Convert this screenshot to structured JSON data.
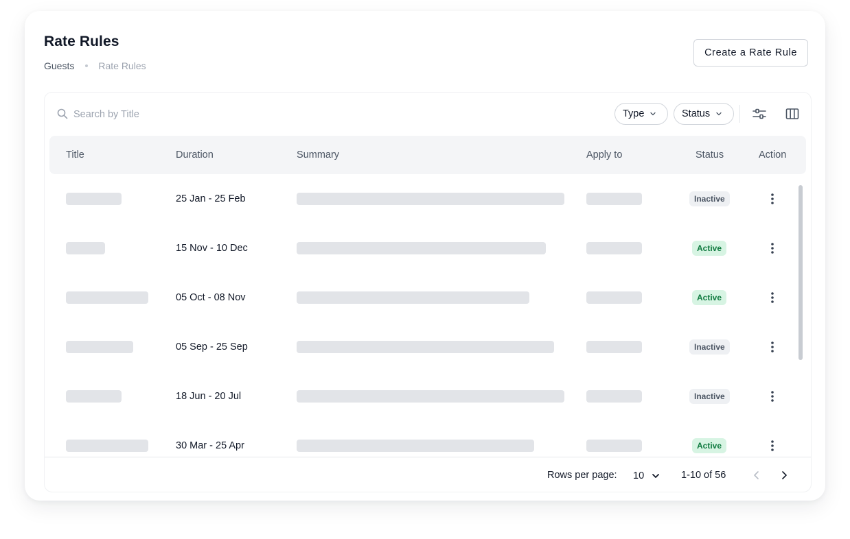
{
  "header": {
    "title": "Rate Rules",
    "breadcrumb": [
      "Guests",
      "Rate Rules"
    ],
    "create_button": "Create a Rate Rule"
  },
  "toolbar": {
    "search_placeholder": "Search by Title",
    "filter_type": "Type",
    "filter_status": "Status",
    "icons": [
      "search-icon",
      "adjustments-icon",
      "columns-icon"
    ]
  },
  "table": {
    "columns": [
      "Title",
      "Duration",
      "Summary",
      "Apply to",
      "Status",
      "Action"
    ],
    "rows": [
      {
        "duration": "25 Jan - 25 Feb",
        "status": "Inactive"
      },
      {
        "duration": "15 Nov - 10 Dec",
        "status": "Active"
      },
      {
        "duration": "05 Oct - 08 Nov",
        "status": "Active"
      },
      {
        "duration": "05 Sep - 25 Sep",
        "status": "Inactive"
      },
      {
        "duration": "18 Jun - 20 Jul",
        "status": "Inactive"
      },
      {
        "duration": "30 Mar - 25 Apr",
        "status": "Active"
      }
    ]
  },
  "pagination": {
    "rows_per_page_label": "Rows per page:",
    "rows_per_page_value": "10",
    "range": "1-10 of 56"
  },
  "colors": {
    "active_badge_bg": "#d7f4e3",
    "active_badge_text": "#0f7a3f",
    "inactive_badge_bg": "#eef0f3",
    "inactive_badge_text": "#4b5563",
    "skeleton": "#e2e4e8"
  }
}
